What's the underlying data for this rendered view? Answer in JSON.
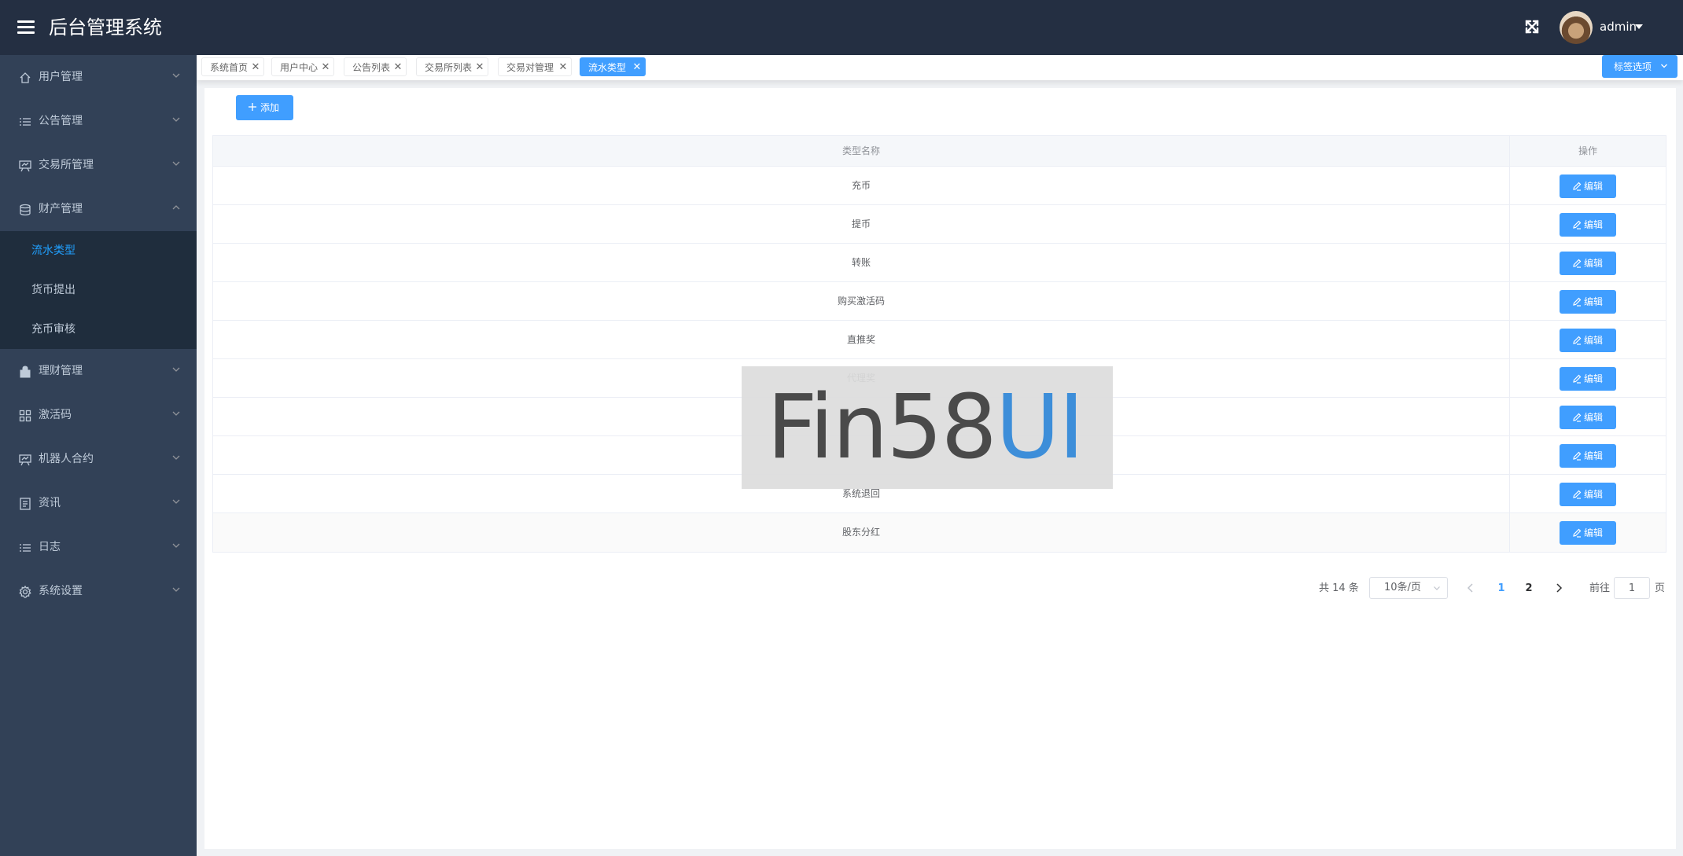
{
  "header": {
    "title": "后台管理系统",
    "user_name": "admin"
  },
  "sidebar": {
    "items": [
      {
        "label": "用户管理",
        "icon": "home-icon"
      },
      {
        "label": "公告管理",
        "icon": "list-icon"
      },
      {
        "label": "交易所管理",
        "icon": "board-icon"
      },
      {
        "label": "财产管理",
        "icon": "database-icon"
      },
      {
        "label": "理财管理",
        "icon": "bag-icon"
      },
      {
        "label": "激活码",
        "icon": "grid-icon"
      },
      {
        "label": "机器人合约",
        "icon": "board-icon"
      },
      {
        "label": "资讯",
        "icon": "document-icon"
      },
      {
        "label": "日志",
        "icon": "list-icon"
      },
      {
        "label": "系统设置",
        "icon": "gear-icon"
      }
    ],
    "sub_items": [
      {
        "label": "流水类型",
        "active": true
      },
      {
        "label": "货币提出",
        "active": false
      },
      {
        "label": "充币审核",
        "active": false
      }
    ]
  },
  "tags": {
    "items": [
      {
        "label": "系统首页"
      },
      {
        "label": "用户中心"
      },
      {
        "label": "公告列表"
      },
      {
        "label": "交易所列表"
      },
      {
        "label": "交易对管理"
      },
      {
        "label": "流水类型"
      }
    ],
    "options_label": "标签选项"
  },
  "toolbar": {
    "add_label": "添加"
  },
  "table": {
    "headers": [
      "类型名称",
      "操作"
    ],
    "edit_label": "编辑",
    "rows": [
      "充币",
      "提币",
      "转账",
      "购买激活码",
      "直推奖",
      "代理奖",
      "",
      "",
      "系统退回",
      "股东分红"
    ]
  },
  "watermark": {
    "text_dark": "Fin58",
    "text_blue": "UI"
  },
  "pagination": {
    "total": "共 14 条",
    "page_size": "10条/页",
    "pages": [
      "1",
      "2"
    ],
    "current_page": "1",
    "goto_label": "前往",
    "goto_value": "1",
    "page_suffix": "页"
  },
  "colors": {
    "header_bg": "#242f42",
    "sidebar_bg": "#324157",
    "submenu_bg": "#1f2d3d",
    "accent": "#409eff",
    "active_text": "#20a0ff"
  }
}
